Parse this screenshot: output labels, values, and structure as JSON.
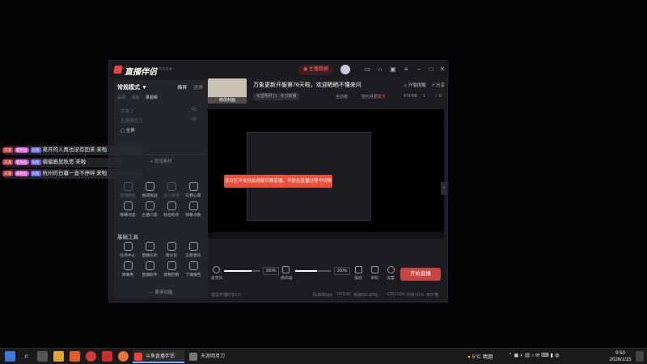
{
  "app": {
    "name": "直播伴侣",
    "version": "6.5.5.4",
    "live_data": "主播数据",
    "accent": "#c8443e"
  },
  "sidebar": {
    "mode": "常规模式",
    "tabs": [
      "横屏",
      "竖屏"
    ],
    "scene_tabs": [
      "关闭",
      "添加",
      "录视频"
    ],
    "sources": [
      {
        "label": "文本 1",
        "num": "45"
      },
      {
        "label": "天涯明月刀",
        "num": "45"
      },
      {
        "label": "全屏",
        "num": ""
      }
    ],
    "add_source": "添加素材",
    "tools_row1": [
      "音频模式",
      "福袋挑战",
      "多人连线",
      "礼物心愿"
    ],
    "tools_row2": [
      "弹幕消息",
      "主播口袋",
      "粉丝助手",
      "弹幕点歌"
    ],
    "basic_tools_title": "基础工具",
    "basic_row1": [
      "任务中心",
      "直播任务",
      "观众台",
      "正版音乐"
    ],
    "basic_row2": [
      "弹幕秀",
      "直播助手",
      "观看回看",
      "下播报告"
    ],
    "more": "更多功能"
  },
  "room": {
    "cover_button": "修改封面",
    "title": "万象更新开服第70天啦，欢迎晒晒不懂来问",
    "category": "天涯明月刀 · 天刀新服",
    "start_live": "开播提醒",
    "share": "分享",
    "stats": [
      "全站榜",
      "签约月费",
      "470788",
      "1",
      "0"
    ],
    "warn_text": "警示"
  },
  "preview": {
    "toast": "该分区不支持此频繁切换直播，不能在直播过程中切换"
  },
  "controls": {
    "mic_label": "麦克风",
    "mic_pct": "150%",
    "mic_fill": 0.78,
    "spk_label": "扬声器",
    "spk_pct": "100%",
    "spk_fill": 0.62,
    "icons": [
      "美颜",
      "录制",
      "设置"
    ],
    "live_button": "开始直播"
  },
  "statusbar": {
    "left": "建议开播时长2.0",
    "items": [
      "码率0Kbps",
      "FPS:60",
      "丢帧0(0.00%)",
      "CPU:13%",
      "内存:41%",
      "未开播"
    ]
  },
  "chat": [
    {
      "badge1": "天涯",
      "badge2": "新粉丝",
      "badge3": "头衔",
      "text": "离开的人再也没有回来 来啦"
    },
    {
      "badge1": "天涯",
      "badge2": "新粉丝",
      "badge3": "头衔",
      "text": "偏偏画显秋思 来啦"
    },
    {
      "badge1": "天涯",
      "badge2": "新粉丝",
      "badge3": "头衔",
      "text": "杭州的日暮一直不停碎 来啦"
    }
  ],
  "taskbar": {
    "tasks": [
      "斗鱼直播伴侣",
      "天涯明月刀"
    ],
    "weather": "5°C 晴朗",
    "time": "9:50",
    "date": "2026/1/15"
  }
}
